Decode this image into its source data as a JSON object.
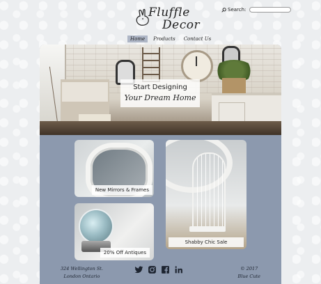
{
  "brand": {
    "line1": "Fluffle",
    "line2": "Decor"
  },
  "search": {
    "label": "Search:",
    "placeholder": ""
  },
  "nav": {
    "items": [
      {
        "label": "Home",
        "active": true
      },
      {
        "label": "Products"
      },
      {
        "label": "Contact Us"
      }
    ]
  },
  "hero": {
    "line1": "Start Designing",
    "line2": "Your Dream Home"
  },
  "tiles": {
    "mirrors": "New Mirrors & Frames",
    "shabby": "Shabby Chic Sale",
    "antiques": "20% Off Antiques"
  },
  "footer": {
    "address_line1": "324 Wellington St.",
    "address_line2": "London Ontario",
    "copyright": "© 2017",
    "company": "Blue Cute"
  },
  "social": [
    "twitter-icon",
    "instagram-icon",
    "facebook-icon",
    "linkedin-icon"
  ],
  "colors": {
    "panel": "#8c99ae",
    "nav_active": "#aeb6c6",
    "text": "#1d2430"
  }
}
